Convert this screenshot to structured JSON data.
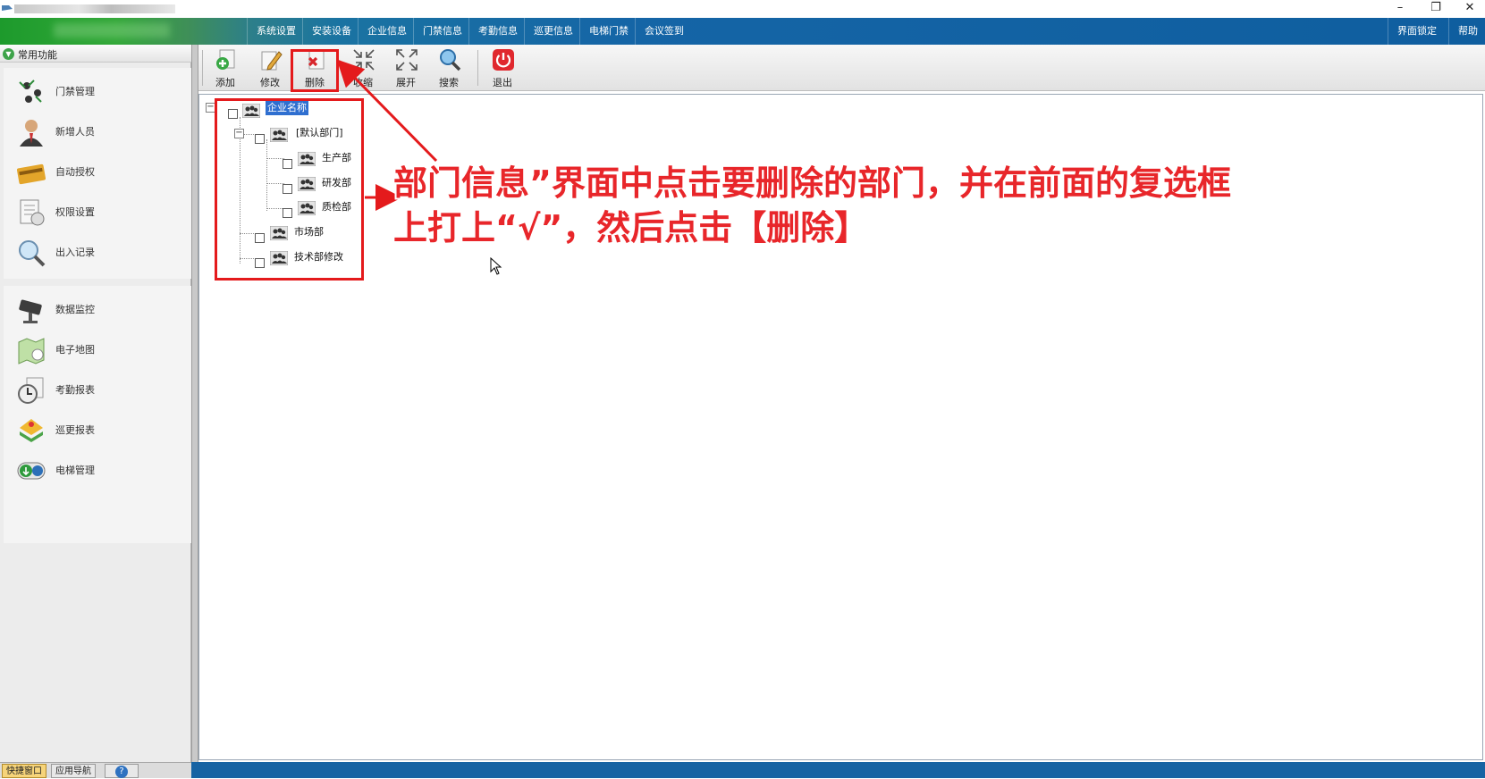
{
  "window": {
    "minimize_glyph": "–",
    "restore_glyph": "❐",
    "close_glyph": "✕"
  },
  "menubar": {
    "items": [
      "系统设置",
      "安装设备",
      "企业信息",
      "门禁信息",
      "考勤信息",
      "巡更信息",
      "电梯门禁",
      "会议签到"
    ],
    "right_items": [
      "界面锁定",
      "帮助"
    ]
  },
  "sidebar": {
    "header": "常用功能",
    "group1": [
      {
        "label": "门禁管理",
        "icon": "door-access-icon"
      },
      {
        "label": "新增人员",
        "icon": "person-icon"
      },
      {
        "label": "自动授权",
        "icon": "card-icon"
      },
      {
        "label": "权限设置",
        "icon": "permission-doc-icon"
      },
      {
        "label": "出入记录",
        "icon": "magnifier-record-icon"
      }
    ],
    "group2": [
      {
        "label": "数据监控",
        "icon": "camera-icon"
      },
      {
        "label": "电子地图",
        "icon": "map-icon"
      },
      {
        "label": "考勤报表",
        "icon": "clock-report-icon"
      },
      {
        "label": "巡更报表",
        "icon": "patrol-icon"
      },
      {
        "label": "电梯管理",
        "icon": "elevator-icon"
      }
    ],
    "footer_tabs": [
      "快捷窗口",
      "应用导航",
      "?"
    ]
  },
  "toolbar": {
    "add": "添加",
    "edit": "修改",
    "delete": "删除",
    "collapse": "收缩",
    "expand": "展开",
    "search": "搜索",
    "exit": "退出"
  },
  "tree": {
    "root": "企业名称",
    "default_dept": "[默认部门]",
    "children_default": [
      "生产部",
      "研发部",
      "质检部"
    ],
    "siblings": [
      "市场部",
      "技术部修改"
    ]
  },
  "annotation": {
    "line1": "部门信息”界面中点击要删除的部门，并在前面的复选框",
    "line2": "上打上“√”，然后点击【删除】"
  },
  "colors": {
    "annotation_red": "#e41a1c",
    "menubar_blue": "#1565a6",
    "selection_blue": "#2f6fd0"
  }
}
